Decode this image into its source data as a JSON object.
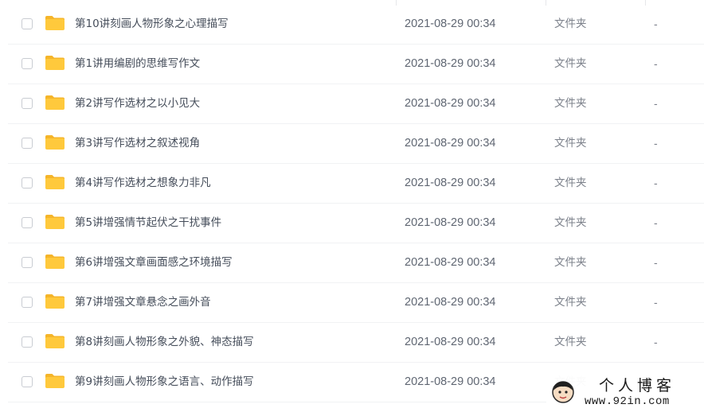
{
  "files": [
    {
      "name": "第10讲刻画人物形象之心理描写",
      "date": "2021-08-29 00:34",
      "type": "文件夹",
      "size": "-",
      "icon": "folder-icon"
    },
    {
      "name": "第1讲用编剧的思维写作文",
      "date": "2021-08-29 00:34",
      "type": "文件夹",
      "size": "-",
      "icon": "folder-icon"
    },
    {
      "name": "第2讲写作选材之以小见大",
      "date": "2021-08-29 00:34",
      "type": "文件夹",
      "size": "-",
      "icon": "folder-icon"
    },
    {
      "name": "第3讲写作选材之叙述视角",
      "date": "2021-08-29 00:34",
      "type": "文件夹",
      "size": "-",
      "icon": "folder-icon"
    },
    {
      "name": "第4讲写作选材之想象力非凡",
      "date": "2021-08-29 00:34",
      "type": "文件夹",
      "size": "-",
      "icon": "folder-icon"
    },
    {
      "name": "第5讲增强情节起伏之干扰事件",
      "date": "2021-08-29 00:34",
      "type": "文件夹",
      "size": "-",
      "icon": "folder-icon"
    },
    {
      "name": "第6讲增强文章画面感之环境描写",
      "date": "2021-08-29 00:34",
      "type": "文件夹",
      "size": "-",
      "icon": "folder-icon"
    },
    {
      "name": "第7讲增强文章悬念之画外音",
      "date": "2021-08-29 00:34",
      "type": "文件夹",
      "size": "-",
      "icon": "folder-icon"
    },
    {
      "name": "第8讲刻画人物形象之外貌、神态描写",
      "date": "2021-08-29 00:34",
      "type": "文件夹",
      "size": "-",
      "icon": "folder-icon"
    },
    {
      "name": "第9讲刻画人物形象之语言、动作描写",
      "date": "2021-08-29 00:34",
      "type": "文件夹",
      "size": "-",
      "icon": "folder-icon"
    }
  ],
  "watermark": {
    "title": "个人博客",
    "url": "www.92in.com"
  },
  "colors": {
    "folder": "#ffc93c",
    "folder_tab": "#f5b52a",
    "name_text": "#454d5a",
    "meta_text": "#7b808a",
    "row_divider": "#f1f2f4"
  }
}
